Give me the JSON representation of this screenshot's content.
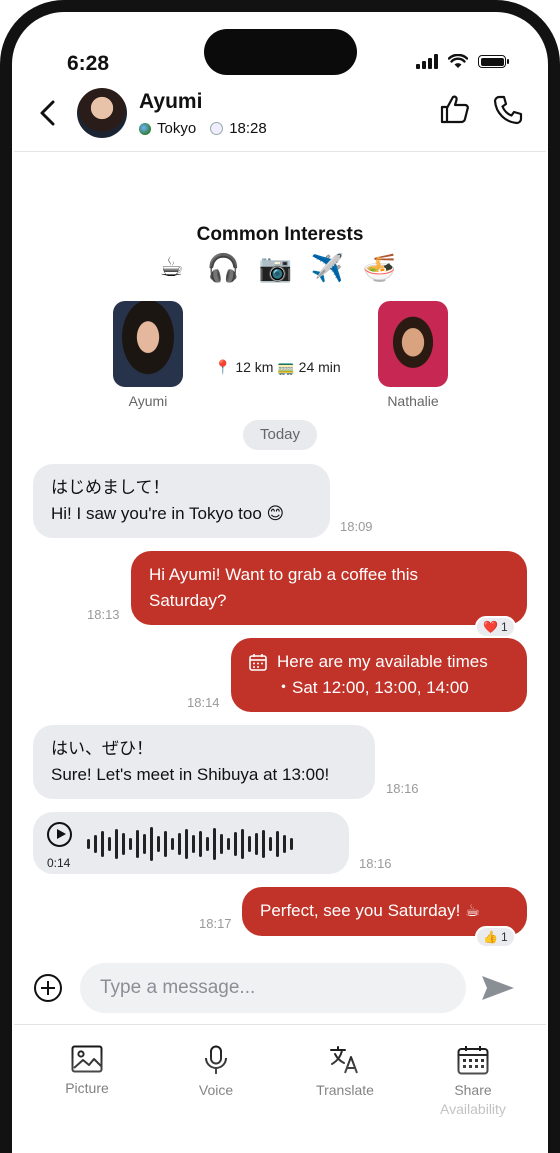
{
  "status": {
    "time": "6:28"
  },
  "header": {
    "name": "Ayumi",
    "city": "Tokyo",
    "local_time": "18:28"
  },
  "interests": {
    "title": "Common Interests",
    "icons": [
      "☕",
      "🎧",
      "📷",
      "✈️",
      "🍜"
    ]
  },
  "match": {
    "left_name": "Ayumi",
    "right_name": "Nathalie",
    "distance": "12 km",
    "travel": "24 min",
    "pin_icon": "📍",
    "train_icon": "🚃"
  },
  "day_label": "Today",
  "messages": [
    {
      "line1": "はじめまして！",
      "line2": "Hi! I saw you're in Tokyo too 😊",
      "time": "18:09"
    },
    {
      "line1": "Hi Ayumi! Want to grab a coffee this",
      "line2": "Saturday?",
      "time": "18:13",
      "reaction": "❤️",
      "reaction_count": "1"
    },
    {
      "line1": "Here are my available times",
      "line2": "・Sat 12:00, 13:00, 14:00",
      "time": "18:14"
    },
    {
      "line1": "はい、ぜひ！",
      "line2": "Sure! Let's meet in Shibuya at 13:00!",
      "time": "18:16"
    },
    {
      "duration": "0:14",
      "time": "18:16"
    },
    {
      "line1": "Perfect, see you Saturday! ☕",
      "time": "18:17",
      "reaction": "👍",
      "reaction_count": "1"
    }
  ],
  "composer": {
    "placeholder": "Type a message..."
  },
  "toolbar": {
    "picture": "Picture",
    "voice": "Voice",
    "translate": "Translate",
    "share": "Share",
    "share_sub": "Availability"
  },
  "colors": {
    "accent": "#c13329",
    "incoming": "#e9ebef"
  }
}
